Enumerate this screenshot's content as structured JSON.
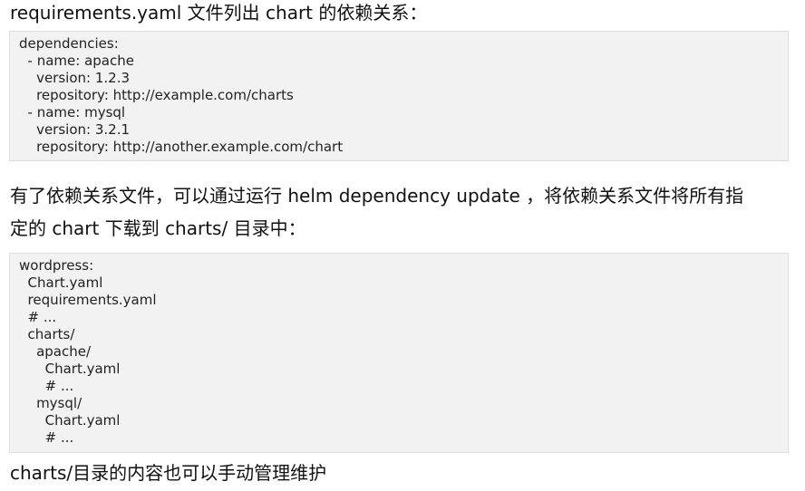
{
  "intro": "requirements.yaml 文件列出 chart 的依赖关系：",
  "code1": [
    "dependencies:",
    "  - name: apache",
    "    version: 1.2.3",
    "    repository: http://example.com/charts",
    "  - name: mysql",
    "    version: 3.2.1",
    "    repository: http://another.example.com/chart"
  ],
  "para2_line1": "有了依赖关系文件，可以通过运行 helm dependency update ，将依赖关系文件将所有指",
  "para2_line2": "定的 chart 下载到 charts/ 目录中：",
  "code2": [
    "wordpress:",
    "  Chart.yaml",
    "  requirements.yaml",
    "  # ...",
    "  charts/",
    "    apache/",
    "      Chart.yaml",
    "      # ...",
    "    mysql/",
    "      Chart.yaml",
    "      # ..."
  ],
  "outro": "charts/目录的内容也可以手动管理维护"
}
